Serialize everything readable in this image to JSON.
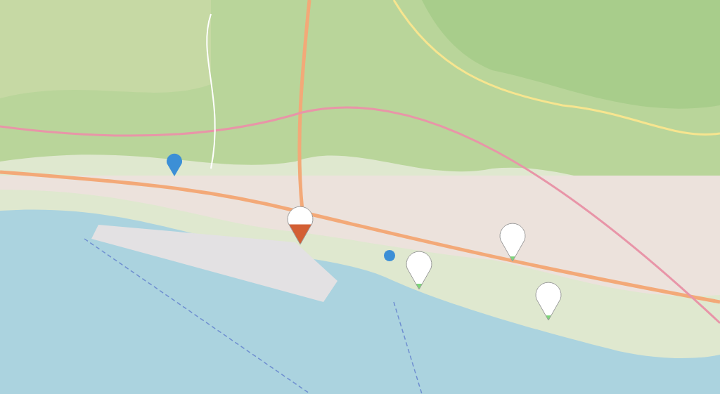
{
  "markers": [
    {
      "kind": "gauge",
      "level": 0.5,
      "color": "#d35f34"
    },
    {
      "kind": "gauge",
      "level": 0.14,
      "color": "#7dd67a"
    },
    {
      "kind": "gauge",
      "level": 0.12,
      "color": "#7dd67a"
    },
    {
      "kind": "gauge",
      "level": 0.12,
      "color": "#7dd67a"
    },
    {
      "kind": "pin",
      "color": "#3c8fd6"
    },
    {
      "kind": "dot",
      "color": "#3c8fd6"
    }
  ]
}
